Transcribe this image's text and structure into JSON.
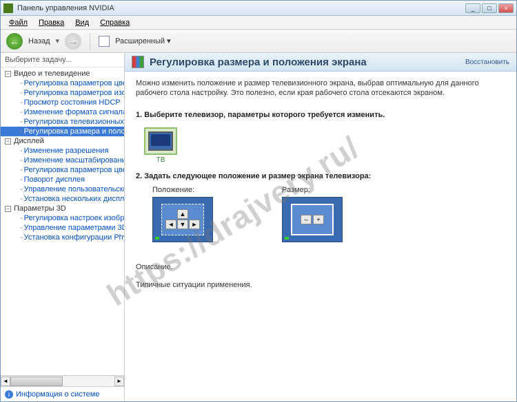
{
  "window": {
    "title": "Панель управления NVIDIA"
  },
  "menubar": [
    "Файл",
    "Правка",
    "Вид",
    "Справка"
  ],
  "toolbar": {
    "back": "Назад",
    "view": "Расширенный"
  },
  "sidebar": {
    "header": "Выберите задачу...",
    "footer": "Информация о системе",
    "cats": [
      {
        "label": "Видео и телевидение",
        "expanded": true,
        "items": [
          "Регулировка параметров цвета для вид",
          "Регулировка параметров изображения д",
          "Просмотр состояния HDCP",
          "Изменение формата сигнала или ТВЧ",
          "Регулировка телевизионных параметро",
          "Регулировка размера и положения экра"
        ],
        "selected": 5
      },
      {
        "label": "Дисплей",
        "expanded": true,
        "items": [
          "Изменение разрешения",
          "Изменение масштабирования для монит",
          "Регулировка параметров цвета рабоче",
          "Поворот дисплея",
          "Управление пользовательским разреше",
          "Установка нескольких дисплеев"
        ]
      },
      {
        "label": "Параметры 3D",
        "expanded": true,
        "items": [
          "Регулировка настроек изображения с пр",
          "Управление параметрами 3D",
          "Установка конфигурации PhysX"
        ]
      }
    ]
  },
  "page": {
    "title": "Регулировка размера и положения экрана",
    "restore": "Восстановить",
    "desc": "Можно изменить положение и размер телевизионного экрана, выбрав оптимальную для данного рабочего стола настройку. Это полезно, если края рабочего стола отсекаются экраном.",
    "step1": "1. Выберите телевизор, параметры которого требуется изменить.",
    "tv_label": "ТВ",
    "step2": "2. Задать следующее положение и размер экрана телевизора:",
    "pos_label": "Положение:",
    "size_label": "Размер:",
    "sect_desc": "Описание.",
    "sect_typical": "Типичные ситуации применения."
  },
  "watermark": "https://drajvery.ru/"
}
